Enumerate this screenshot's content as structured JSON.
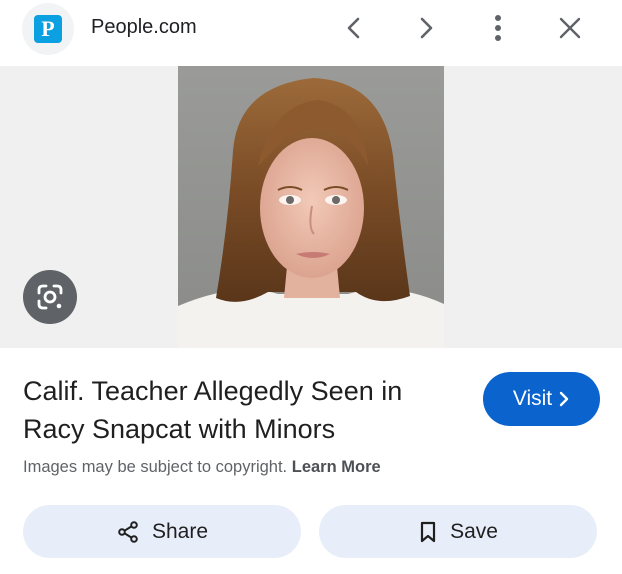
{
  "header": {
    "site_logo_letter": "P",
    "site_name": "People.com",
    "icons": {
      "back": "chevron-left-icon",
      "forward": "chevron-right-icon",
      "more": "more-vertical-icon",
      "close": "close-icon"
    }
  },
  "image": {
    "lens_icon": "google-lens-icon"
  },
  "result": {
    "title": "Calif. Teacher Allegedly Seen in Racy Snapcat with Minors",
    "visit_label": "Visit",
    "copyright_text": "Images may be subject to copyright.",
    "learn_more_label": "Learn More"
  },
  "actions": {
    "share_label": "Share",
    "save_label": "Save"
  },
  "colors": {
    "accent": "#0b63ce",
    "action_button_bg": "#e8eef9",
    "logo_blue": "#0ba0e2",
    "image_bg": "#f0f0f1"
  }
}
